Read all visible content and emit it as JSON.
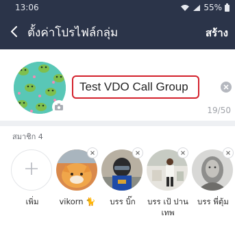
{
  "status_bar": {
    "time": "13:06",
    "battery": "55%"
  },
  "header": {
    "title": "ตั้งค่าโปรไฟล์กลุ่ม",
    "action_label": "สร้าง"
  },
  "profile": {
    "group_name": "Test VDO Call Group",
    "char_count": "19/50"
  },
  "members": {
    "label": "สมาชิก 4",
    "add_label": "เพิ่ม",
    "items": [
      {
        "name": "vikorn 🐈"
      },
      {
        "name": "บรร บิ๊ก"
      },
      {
        "name": "บรร เป้ ปานเทพ"
      },
      {
        "name": "บรร พี่ตุ้ม"
      }
    ]
  },
  "colors": {
    "header_bg": "#2b3449",
    "input_border": "#d3202b",
    "avatar_bg": "#59c7b6",
    "divider": "#eef0f3"
  },
  "icons": [
    "back-arrow-icon",
    "wifi-icon",
    "signal-icon",
    "battery-icon",
    "camera-icon",
    "clear-icon",
    "plus-icon",
    "remove-icon"
  ]
}
